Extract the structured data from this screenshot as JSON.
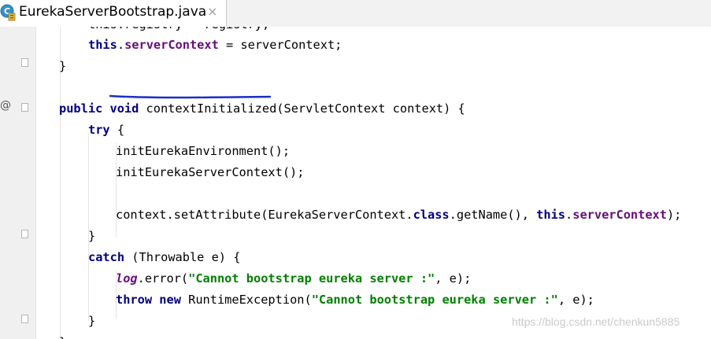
{
  "tab": {
    "file_name": "EurekaServerBootstrap.java",
    "close_glyph": "×",
    "icon_letter": "C"
  },
  "gutter": {
    "override_marker": "@"
  },
  "code": {
    "lines": [
      [
        {
          "t": "plain",
          "v": "this.registry = registry;"
        }
      ],
      [
        {
          "t": "kw",
          "v": "this"
        },
        {
          "t": "plain",
          "v": "."
        },
        {
          "t": "fld",
          "v": "serverContext"
        },
        {
          "t": "plain",
          "v": " = serverContext;"
        }
      ],
      [
        {
          "t": "plain",
          "v": "}"
        }
      ],
      [],
      [
        {
          "t": "kw",
          "v": "public"
        },
        {
          "t": "plain",
          "v": " "
        },
        {
          "t": "kw",
          "v": "void"
        },
        {
          "t": "plain",
          "v": " contextInitialized(ServletContext context) {"
        }
      ],
      [
        {
          "t": "kw",
          "v": "try"
        },
        {
          "t": "plain",
          "v": " {"
        }
      ],
      [
        {
          "t": "plain",
          "v": "initEurekaEnvironment();"
        }
      ],
      [
        {
          "t": "plain",
          "v": "initEurekaServerContext();"
        }
      ],
      [],
      [
        {
          "t": "plain",
          "v": "context.setAttribute(EurekaServerContext."
        },
        {
          "t": "kw",
          "v": "class"
        },
        {
          "t": "plain",
          "v": ".getName(), "
        },
        {
          "t": "kw",
          "v": "this"
        },
        {
          "t": "plain",
          "v": "."
        },
        {
          "t": "fld",
          "v": "serverContext"
        },
        {
          "t": "plain",
          "v": ");"
        }
      ],
      [
        {
          "t": "plain",
          "v": "}"
        }
      ],
      [
        {
          "t": "kw",
          "v": "catch"
        },
        {
          "t": "plain",
          "v": " (Throwable e) {"
        }
      ],
      [
        {
          "t": "stat",
          "v": "log"
        },
        {
          "t": "plain",
          "v": ".error("
        },
        {
          "t": "str",
          "v": "\"Cannot bootstrap eureka server :\""
        },
        {
          "t": "plain",
          "v": ", e);"
        }
      ],
      [
        {
          "t": "kw",
          "v": "throw"
        },
        {
          "t": "plain",
          "v": " "
        },
        {
          "t": "kw",
          "v": "new"
        },
        {
          "t": "plain",
          "v": " RuntimeException("
        },
        {
          "t": "str",
          "v": "\"Cannot bootstrap eureka server :\""
        },
        {
          "t": "plain",
          "v": ", e);"
        }
      ],
      [
        {
          "t": "plain",
          "v": "}"
        }
      ],
      [
        {
          "t": "plain",
          "v": "}"
        }
      ]
    ]
  },
  "watermark": "https://blog.csdn.net/chenkun5885",
  "colors": {
    "keyword": "#000080",
    "field": "#660e7a",
    "string": "#008000",
    "annotation_underline": "#1a2fc4"
  }
}
